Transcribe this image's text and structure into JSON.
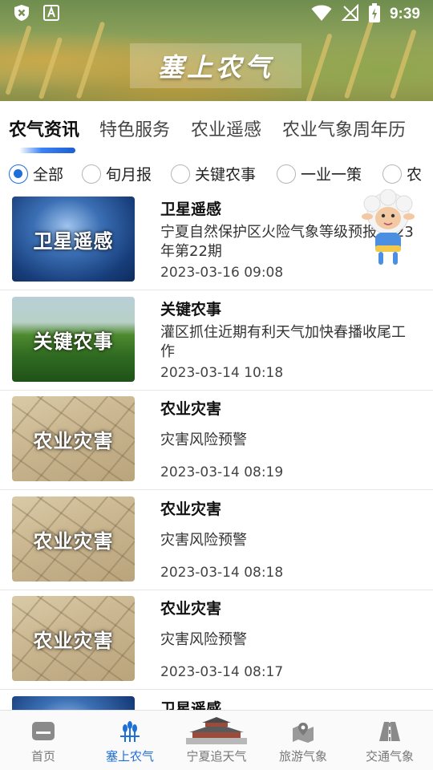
{
  "status_bar": {
    "time": "9:39",
    "icons": [
      "shield-x-icon",
      "text-a-icon",
      "wifi-icon",
      "no-signal-icon",
      "battery-charging-icon"
    ]
  },
  "banner": {
    "title": "塞上农气"
  },
  "category_tabs": {
    "items": [
      {
        "label": "农气资讯",
        "active": true
      },
      {
        "label": "特色服务",
        "active": false
      },
      {
        "label": "农业遥感",
        "active": false
      },
      {
        "label": "农业气象周年历",
        "active": false
      }
    ],
    "indicator_color": "#1e6fd9"
  },
  "filters": {
    "items": [
      {
        "label": "全部",
        "selected": true
      },
      {
        "label": "旬月报",
        "selected": false
      },
      {
        "label": "关键农事",
        "selected": false
      },
      {
        "label": "一业一策",
        "selected": false
      },
      {
        "label": "农",
        "selected": false
      }
    ]
  },
  "news": [
    {
      "category": "卫星遥感",
      "thumb_text": "卫星遥感",
      "summary": "宁夏自然保护区火险气象等级预报2023年第22期",
      "time": "2023-03-16 09:08"
    },
    {
      "category": "关键农事",
      "thumb_text": "关键农事",
      "summary": "灌区抓住近期有利天气加快春播收尾工作",
      "time": "2023-03-14 10:18"
    },
    {
      "category": "农业灾害",
      "thumb_text": "农业灾害",
      "summary": "灾害风险预警",
      "time": "2023-03-14 08:19"
    },
    {
      "category": "农业灾害",
      "thumb_text": "农业灾害",
      "summary": "灾害风险预警",
      "time": "2023-03-14 08:18"
    },
    {
      "category": "农业灾害",
      "thumb_text": "农业灾害",
      "summary": "灾害风险预警",
      "time": "2023-03-14 08:17"
    },
    {
      "category": "卫星遥感",
      "thumb_text": "",
      "summary": "",
      "time": ""
    }
  ],
  "bottom_nav": {
    "items": [
      {
        "label": "首页",
        "icon": "home-icon",
        "active": false
      },
      {
        "label": "塞上农气",
        "icon": "wheat-icon",
        "active": true
      },
      {
        "label": "宁夏追天气",
        "icon": "tower-icon",
        "active": false
      },
      {
        "label": "旅游气象",
        "icon": "map-pin-icon",
        "active": false
      },
      {
        "label": "交通气象",
        "icon": "road-icon",
        "active": false
      }
    ],
    "active_color": "#1e6fd9"
  }
}
